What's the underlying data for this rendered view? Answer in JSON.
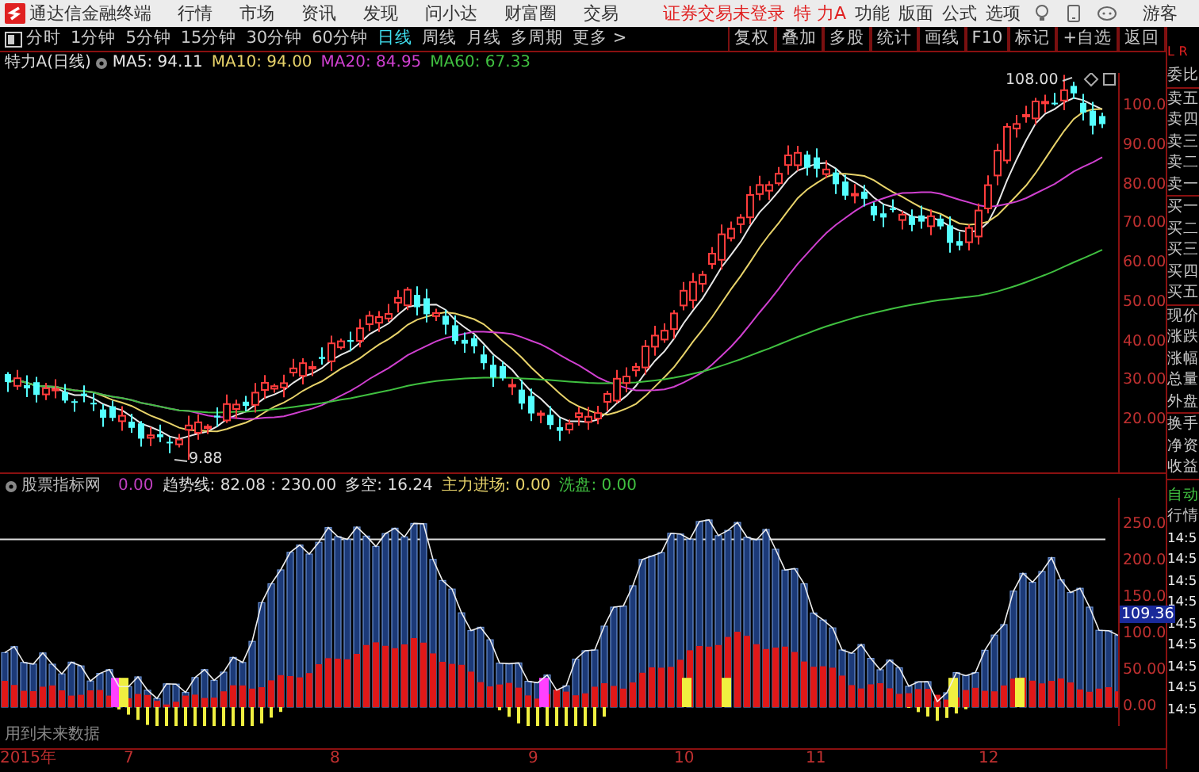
{
  "app_bar": {
    "title": "通达信金融终端",
    "menus": [
      "行情",
      "市场",
      "资讯",
      "发现",
      "问小达",
      "财富圈",
      "交易"
    ],
    "login_status": "证券交易未登录",
    "stock_name": "特 力A",
    "actions": [
      "功能",
      "版面",
      "公式",
      "选项"
    ],
    "user": "游客"
  },
  "period_tabs": [
    {
      "label": "分时",
      "selected": false
    },
    {
      "label": "1分钟",
      "selected": false
    },
    {
      "label": "5分钟",
      "selected": false
    },
    {
      "label": "15分钟",
      "selected": false
    },
    {
      "label": "30分钟",
      "selected": false
    },
    {
      "label": "60分钟",
      "selected": false
    },
    {
      "label": "日线",
      "selected": true
    },
    {
      "label": "周线",
      "selected": false
    },
    {
      "label": "月线",
      "selected": false
    },
    {
      "label": "多周期",
      "selected": false
    },
    {
      "label": "更多 >",
      "selected": false
    }
  ],
  "tool_buttons": [
    "复权",
    "叠加",
    "多股",
    "统计",
    "画线",
    "F10",
    "标记",
    "+自选",
    "返回"
  ],
  "main_chart": {
    "title": "特力A(日线)",
    "ma": [
      {
        "label": "MA5: 94.11",
        "color": "#e8e8e8"
      },
      {
        "label": "MA10: 94.00",
        "color": "#e8d36a"
      },
      {
        "label": "MA20: 84.95",
        "color": "#d040d0"
      },
      {
        "label": "MA60: 67.33",
        "color": "#40c040"
      }
    ],
    "high_label": "108.00",
    "low_label": "9.88",
    "y_labels": [
      "100.0",
      "90.00",
      "80.00",
      "70.00",
      "60.00",
      "50.00",
      "40.00",
      "30.00",
      "20.00"
    ]
  },
  "indicator": {
    "name": "股票指标网",
    "items": [
      {
        "label": "0.00",
        "color": "#c040c0"
      },
      {
        "label": "趋势线: 82.08 : 230.00",
        "color": "#dddddd"
      },
      {
        "label": "多空: 16.24",
        "color": "#dddddd"
      },
      {
        "label": "主力进场: 0.00",
        "color": "#e8d36a"
      },
      {
        "label": "洗盘: 0.00",
        "color": "#40c040"
      }
    ],
    "y_labels": [
      "250.0",
      "200.0",
      "150.0",
      "100.0",
      "50.00",
      "0.00"
    ],
    "current_value": "109.36",
    "note": "用到未来数据"
  },
  "date_axis": [
    "2015年",
    "7",
    "8",
    "9",
    "10",
    "11",
    "12"
  ],
  "quote_panel": {
    "corner_marks": [
      "L",
      "R"
    ],
    "groups": [
      [
        "委比"
      ],
      [
        "卖五",
        "卖四",
        "卖三",
        "卖二",
        "卖一"
      ],
      [
        "买一",
        "买二",
        "买三",
        "买四",
        "买五"
      ],
      [
        "现价",
        "涨跌",
        "涨幅",
        "总量",
        "外盘"
      ],
      [
        "换手",
        "净资",
        "收益"
      ]
    ],
    "mode": "自动",
    "section": "行情",
    "times": [
      "14:5",
      "14:5",
      "14:5",
      "14:5",
      "14:5",
      "14:5",
      "14:5",
      "14:5",
      "14:5"
    ]
  }
}
